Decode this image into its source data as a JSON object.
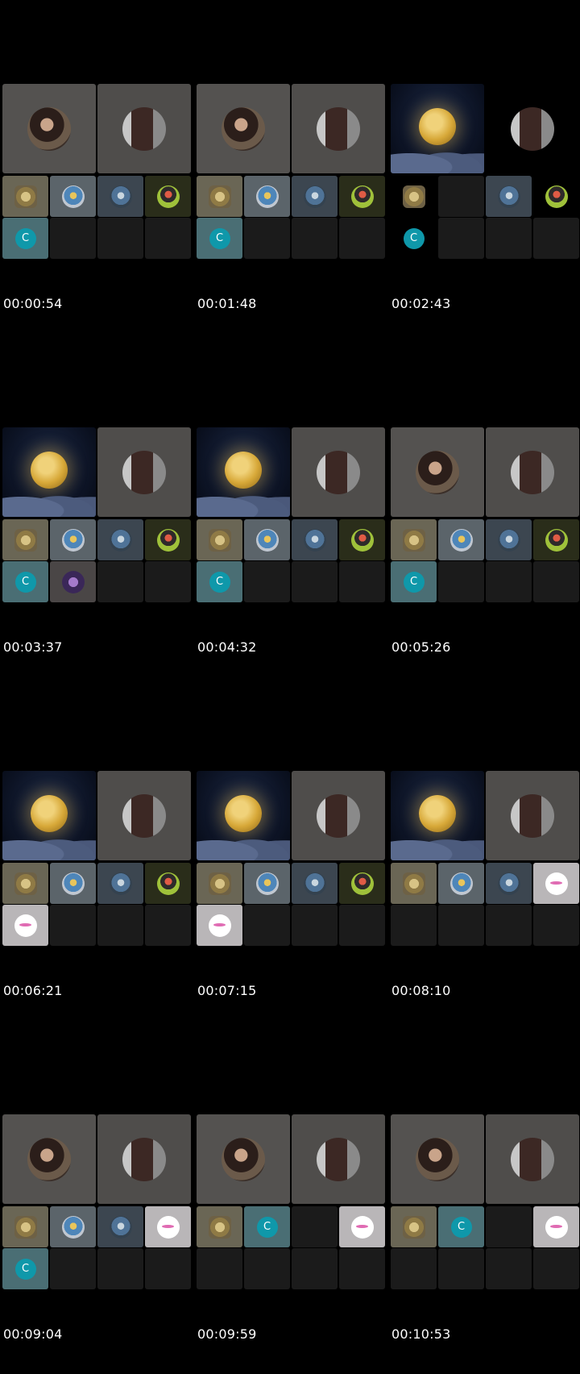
{
  "frames": [
    {
      "time": "00:00:54"
    },
    {
      "time": "00:01:48"
    },
    {
      "time": "00:02:43"
    },
    {
      "time": "00:03:37"
    },
    {
      "time": "00:04:32"
    },
    {
      "time": "00:05:26"
    },
    {
      "time": "00:06:21"
    },
    {
      "time": "00:07:15"
    },
    {
      "time": "00:08:10"
    },
    {
      "time": "00:09:04"
    },
    {
      "time": "00:09:59"
    },
    {
      "time": "00:10:53"
    }
  ],
  "avatar_initial": "C",
  "colors": {
    "background": "#000000",
    "tile": "#545250",
    "empty_tile": "#1b1b1b",
    "avatar_c": "#0f98aa"
  }
}
